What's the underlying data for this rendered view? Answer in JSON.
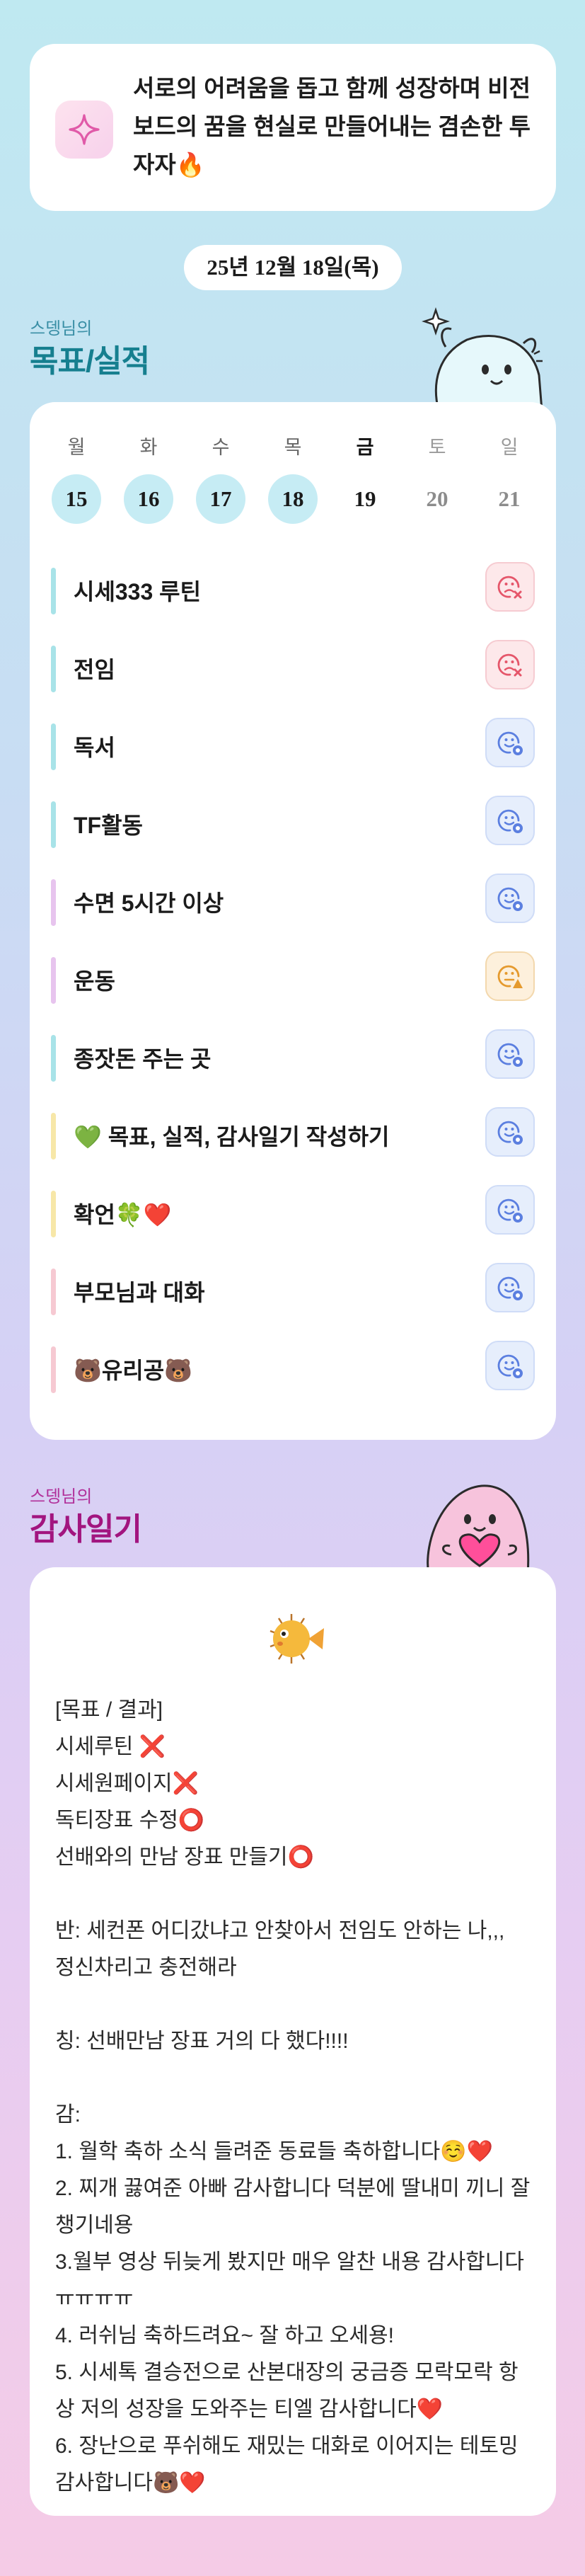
{
  "motto": {
    "icon": "sparkle-icon",
    "text": "서로의 어려움을 돕고 함께 성장하며 비전보드의 꿈을 현실로 만들어내는 겸손한 투자자🔥"
  },
  "date": "25년 12월 18일(목)",
  "goals_section": {
    "subtitle": "스뎅님의",
    "title": "목표/실적"
  },
  "week": [
    {
      "dow": "월",
      "day": "15",
      "state": "done"
    },
    {
      "dow": "화",
      "day": "16",
      "state": "done"
    },
    {
      "dow": "수",
      "day": "17",
      "state": "done"
    },
    {
      "dow": "목",
      "day": "18",
      "state": "done"
    },
    {
      "dow": "금",
      "day": "19",
      "state": "today"
    },
    {
      "dow": "토",
      "day": "20",
      "state": "future"
    },
    {
      "dow": "일",
      "day": "21",
      "state": "future"
    }
  ],
  "goals": [
    {
      "label": "시세333 루틴",
      "status": "fail",
      "bar": "#a8e3e8"
    },
    {
      "label": "전임",
      "status": "fail",
      "bar": "#a8e3e8"
    },
    {
      "label": "독서",
      "status": "ok",
      "bar": "#a8e3e8"
    },
    {
      "label": "TF활동",
      "status": "ok",
      "bar": "#a8e3e8"
    },
    {
      "label": "수면 5시간 이상",
      "status": "ok",
      "bar": "#e7c4ee"
    },
    {
      "label": "운동",
      "status": "warn",
      "bar": "#e7c4ee"
    },
    {
      "label": "종잣돈 주는 곳",
      "status": "ok",
      "bar": "#a8e3e8"
    },
    {
      "label": "💚 목표, 실적, 감사일기 작성하기",
      "status": "ok",
      "bar": "#f7e7a8"
    },
    {
      "label": "확언🍀❤️",
      "status": "ok",
      "bar": "#f7e7a8"
    },
    {
      "label": "부모님과 대화",
      "status": "ok",
      "bar": "#f6c9d2"
    },
    {
      "label": "🐻유리공🐻",
      "status": "ok",
      "bar": "#f6c9d2"
    }
  ],
  "status_colors": {
    "ok": "#5b7fe0",
    "fail": "#e5566a",
    "warn": "#e59a2e"
  },
  "gratitude_section": {
    "subtitle": "스뎅님의",
    "title": "감사일기"
  },
  "journal_icon": "pufferfish-icon",
  "journal_text": "[목표 / 결과]\n시세루틴 ❌\n시세원페이지❌\n독티장표 수정⭕\n선배와의 만남 장표 만들기⭕\n\n반: 세컨폰 어디갔냐고 안찾아서 전임도 안하는 나,,,\n정신차리고 충전해라\n\n칭: 선배만남 장표 거의 다 했다!!!!\n\n감:\n1. 월학 축하 소식 들려준 동료들 축하합니다☺️❤️\n2. 찌개 끓여준 아빠 감사합니다 덕분에 딸내미 끼니 잘챙기네용\n3.월부 영상 뒤늦게 봤지만 매우 알찬 내용 감사합니다ㅠㅠㅠㅠ\n4. 러쉬님 축하드려요~ 잘 하고 오세용!\n5. 시세톡 결승전으로 산본대장의 궁금증 모락모락 항상 저의 성장을 도와주는 티엘 감사합니다❤️\n6. 장난으로 푸쉬해도 재밌는 대화로 이어지는 테토밍 감사합니다🐻❤️"
}
